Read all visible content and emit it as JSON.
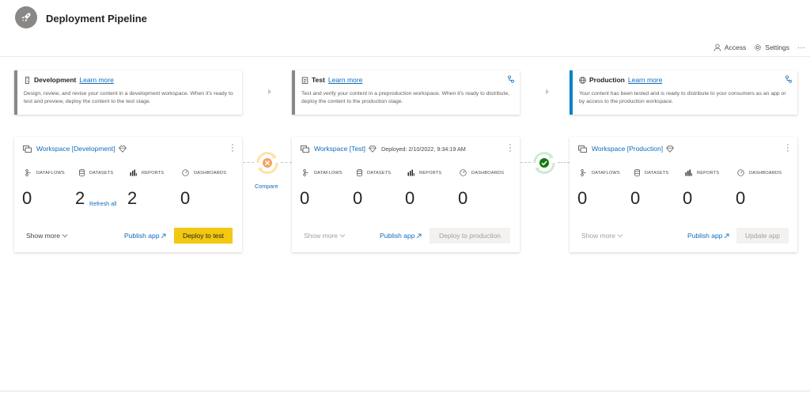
{
  "header": {
    "title": "Deployment Pipeline",
    "access_label": "Access",
    "settings_label": "Settings",
    "more_label": "···"
  },
  "stages": [
    {
      "name": "Development",
      "learn_more": "Learn more",
      "description": "Design, review, and revise your content in a development workspace. When it's ready to test and preview, deploy the content to the test stage."
    },
    {
      "name": "Test",
      "learn_more": "Learn more",
      "description": "Test and verify your content in a preproduction workspace. When it's ready to distribute, deploy the content to the production stage."
    },
    {
      "name": "Production",
      "learn_more": "Learn more",
      "description": "Your content has been tested and is ready to distribute to your consumers as an app or by access to the production workspace."
    }
  ],
  "metric_labels": {
    "dataflows": "DATAFLOWS",
    "datasets": "DATASETS",
    "reports": "REPORTS",
    "dashboards": "DASHBOARDS"
  },
  "workspaces": [
    {
      "name": "Workspace [Development]",
      "deployed": "",
      "dataflows": "0",
      "datasets": "2",
      "reports": "2",
      "dashboards": "0",
      "refresh_all": "Refresh all",
      "show_more": "Show more",
      "publish": "Publish app",
      "action": "Deploy to test"
    },
    {
      "name": "Workspace [Test]",
      "deployed": "Deployed: 2/10/2022, 9:34:19 AM",
      "dataflows": "0",
      "datasets": "0",
      "reports": "0",
      "dashboards": "0",
      "show_more": "Show more",
      "publish": "Publish app",
      "action": "Deploy to production"
    },
    {
      "name": "Workspace [Production]",
      "deployed": "",
      "dataflows": "0",
      "datasets": "0",
      "reports": "0",
      "dashboards": "0",
      "show_more": "Show more",
      "publish": "Publish app",
      "action": "Update app"
    }
  ],
  "compare": {
    "label": "Compare",
    "dev_test_status": "different",
    "test_prod_status": "same"
  },
  "colors": {
    "accent": "#f2c811",
    "link": "#0f6cbd",
    "production_stripe": "#0a84c6",
    "warning": "#f4a261",
    "success": "#107c10"
  }
}
